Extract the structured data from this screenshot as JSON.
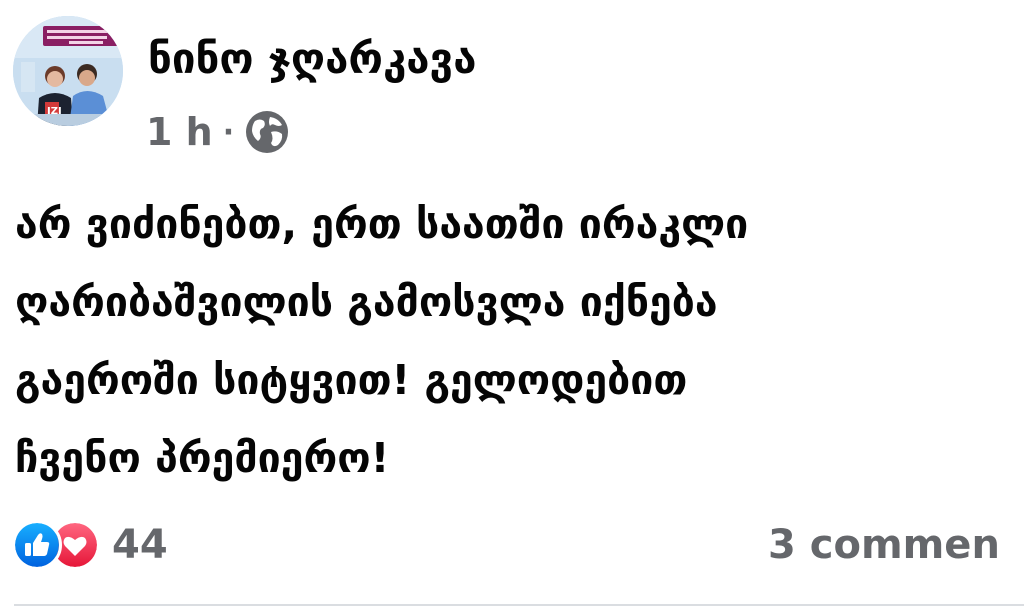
{
  "author": {
    "name": "ნინო ჯღარკავა"
  },
  "meta": {
    "time": "1 h",
    "separator": "·",
    "audience_icon": "globe-icon"
  },
  "post": {
    "lines": [
      "არ ვიძინებთ, ერთ საათში ირაკლი",
      "ღარიბაშვილის გამოსვლა იქნება",
      "გაეროში სიტყვით! გელოდებით",
      "ჩვენო პრემიერო!"
    ]
  },
  "footer": {
    "reaction_icons": [
      "like-icon",
      "love-icon"
    ],
    "reaction_count": "44",
    "comments_label": "3 commen"
  },
  "colors": {
    "text": "#050505",
    "secondary": "#65676b",
    "like_blue": "#1877f2",
    "love_red": "#f33e58",
    "divider": "#dadde1"
  }
}
